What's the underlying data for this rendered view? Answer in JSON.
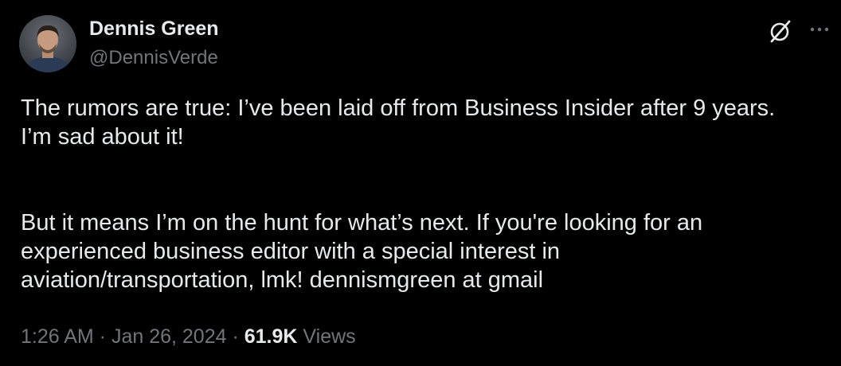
{
  "author": {
    "name": "Dennis Green",
    "handle": "@DennisVerde"
  },
  "icons": {
    "grok": "grok-icon",
    "more": "more-horizontal-icon"
  },
  "tweet": {
    "paragraph1_line1": "The rumors are true: I’ve been laid off from Business Insider after 9 years.",
    "paragraph1_line2": "I’m sad about it!",
    "paragraph2_line1": "But it means I’m on the hunt for what’s next. If you're looking for an",
    "paragraph2_line2": "experienced business editor with a special interest in",
    "paragraph2_line3": "aviation/transportation, lmk! dennismgreen at gmail"
  },
  "meta": {
    "time": "1:26 AM",
    "separator": " · ",
    "date": "Jan 26, 2024",
    "views_count": "61.9K",
    "views_label": "Views"
  },
  "colors": {
    "background": "#000000",
    "text_primary": "#e7e9ea",
    "text_secondary": "#71767b"
  }
}
